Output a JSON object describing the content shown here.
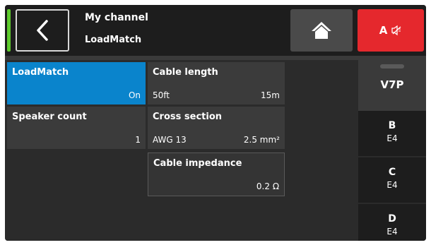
{
  "header": {
    "title": "My channel",
    "subtitle": "LoadMatch",
    "mute_label": "A",
    "colors": {
      "status": "#5ecb2c",
      "mute_bg": "#e5282d",
      "accent": "#0a84cc"
    }
  },
  "tiles": {
    "loadmatch": {
      "title": "LoadMatch",
      "value": "On"
    },
    "cable_length": {
      "title": "Cable length",
      "value_left": "50ft",
      "value_right": "15m"
    },
    "speaker_count": {
      "title": "Speaker count",
      "value": "1"
    },
    "cross_section": {
      "title": "Cross section",
      "value_left": "AWG 13",
      "value_right": "2.5 mm²"
    },
    "cable_impedance": {
      "title": "Cable impedance",
      "value": "0.2 Ω"
    }
  },
  "sidebar": {
    "top": {
      "name": "V7P"
    },
    "items": [
      {
        "name": "B",
        "value": "E4"
      },
      {
        "name": "C",
        "value": "E4"
      },
      {
        "name": "D",
        "value": "E4"
      }
    ]
  },
  "icons": [
    "back-arrow-icon",
    "home-icon",
    "mute-speaker-icon"
  ]
}
